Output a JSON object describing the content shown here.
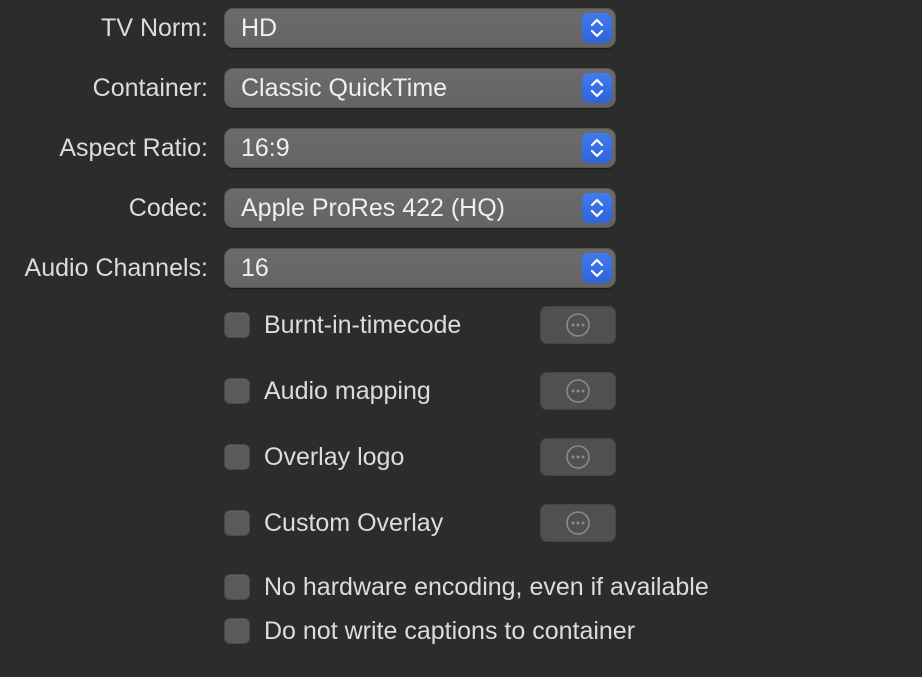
{
  "fields": [
    {
      "label": "TV Norm:",
      "value": "HD"
    },
    {
      "label": "Container:",
      "value": "Classic QuickTime"
    },
    {
      "label": "Aspect Ratio:",
      "value": "16:9"
    },
    {
      "label": "Codec:",
      "value": "Apple ProRes 422 (HQ)"
    },
    {
      "label": "Audio Channels:",
      "value": "16"
    }
  ],
  "options": [
    {
      "label": "Burnt-in-timecode",
      "checked": false,
      "has_more_button": true
    },
    {
      "label": "Audio mapping",
      "checked": false,
      "has_more_button": true
    },
    {
      "label": "Overlay logo",
      "checked": false,
      "has_more_button": true
    },
    {
      "label": "Custom Overlay",
      "checked": false,
      "has_more_button": true
    },
    {
      "label": "No hardware encoding, even if available",
      "checked": false,
      "has_more_button": false
    },
    {
      "label": "Do not write captions to container",
      "checked": false,
      "has_more_button": false
    }
  ],
  "icons": {
    "popup_stepper": "chevron-up-down-icon",
    "more_button": "ellipsis-circle-icon"
  },
  "colors": {
    "background": "#2c2c2c",
    "accent": "#3f7cf0"
  }
}
